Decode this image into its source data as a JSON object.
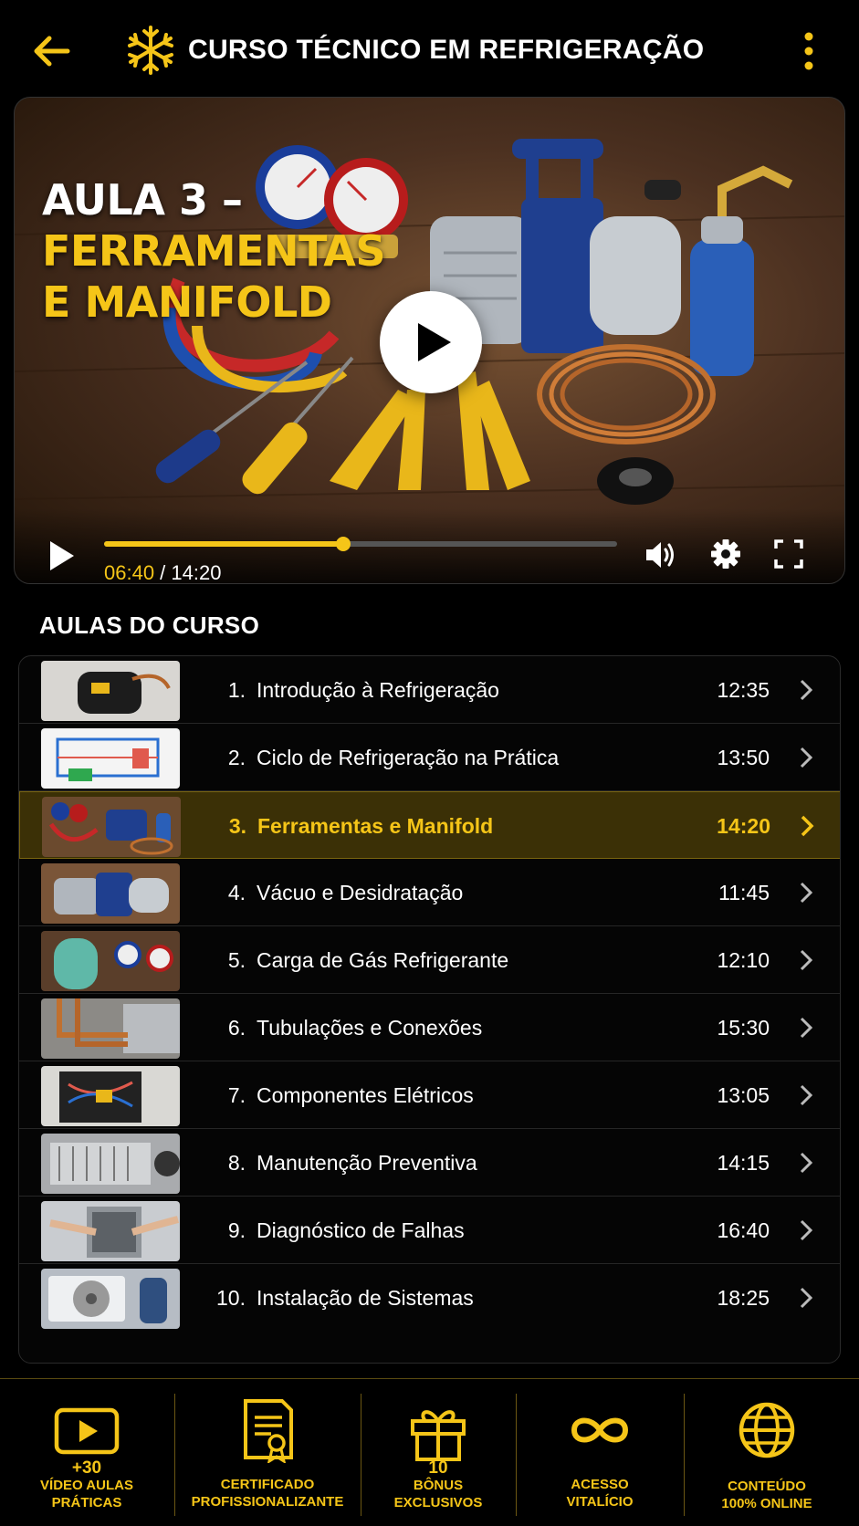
{
  "header": {
    "title": "CURSO TÉCNICO EM REFRIGERAÇÃO",
    "back_icon": "arrow-left-icon",
    "logo_icon": "snowflake-icon",
    "menu_icon": "kebab-menu-icon"
  },
  "player": {
    "overlay_line1": "AULA 3 –",
    "overlay_line2": "FERRAMENTAS",
    "overlay_line3": "E MANIFOLD",
    "current_time": "06:40",
    "separator": " / ",
    "total_time": "14:20",
    "progress_fraction": 0.467
  },
  "section_title": "AULAS DO CURSO",
  "lessons": [
    {
      "num": "1.",
      "title": "Introdução à Refrigeração",
      "duration": "12:35"
    },
    {
      "num": "2.",
      "title": "Ciclo de Refrigeração na Prática",
      "duration": "13:50"
    },
    {
      "num": "3.",
      "title": "Ferramentas e Manifold",
      "duration": "14:20",
      "active": true
    },
    {
      "num": "4.",
      "title": "Vácuo e Desidratação",
      "duration": "11:45"
    },
    {
      "num": "5.",
      "title": "Carga de Gás Refrigerante",
      "duration": "12:10"
    },
    {
      "num": "6.",
      "title": "Tubulações e Conexões",
      "duration": "15:30"
    },
    {
      "num": "7.",
      "title": "Componentes Elétricos",
      "duration": "13:05"
    },
    {
      "num": "8.",
      "title": "Manutenção Preventiva",
      "duration": "14:15"
    },
    {
      "num": "9.",
      "title": "Diagnóstico de Falhas",
      "duration": "16:40"
    },
    {
      "num": "10.",
      "title": "Instalação de Sistemas",
      "duration": "18:25"
    }
  ],
  "features": [
    {
      "number": "+30",
      "line1": "VÍDEO AULAS",
      "line2": "PRÁTICAS",
      "icon": "video-play-icon"
    },
    {
      "number": "",
      "line1": "CERTIFICADO",
      "line2": "PROFISSIONALIZANTE",
      "icon": "certificate-icon"
    },
    {
      "number": "10",
      "line1": "BÔNUS",
      "line2": "EXCLUSIVOS",
      "icon": "gift-icon"
    },
    {
      "number": "",
      "line1": "ACESSO",
      "line2": "VITALÍCIO",
      "icon": "infinity-icon"
    },
    {
      "number": "",
      "line1": "CONTEÚDO",
      "line2": "100% ONLINE",
      "icon": "globe-icon"
    }
  ],
  "colors": {
    "accent": "#f5c518",
    "background": "#000000",
    "active_row": "#3b3006"
  }
}
